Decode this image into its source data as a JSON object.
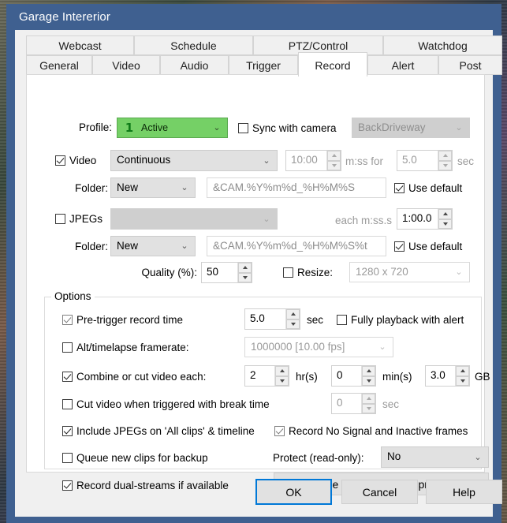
{
  "window": {
    "title": "Garage Intererior"
  },
  "tabs": {
    "top_row": [
      {
        "label": "Webcast",
        "selected": false
      },
      {
        "label": "Schedule",
        "selected": false
      },
      {
        "label": "PTZ/Control",
        "selected": false
      },
      {
        "label": "Watchdog",
        "selected": false
      }
    ],
    "bottom_row": [
      {
        "label": "General",
        "selected": false
      },
      {
        "label": "Video",
        "selected": false
      },
      {
        "label": "Audio",
        "selected": false
      },
      {
        "label": "Trigger",
        "selected": false
      },
      {
        "label": "Record",
        "selected": true
      },
      {
        "label": "Alert",
        "selected": false
      },
      {
        "label": "Post",
        "selected": false
      }
    ]
  },
  "profile_row": {
    "label": "Profile:",
    "profile_number": "1",
    "profile_value": "Active",
    "sync_label": "Sync with camera",
    "sync_checked": false,
    "camera_value": "BackDriveway",
    "camera_disabled": true
  },
  "video_row": {
    "checkbox_label": "Video",
    "checked": true,
    "mode_value": "Continuous",
    "duration_value": "10:00",
    "duration_unit": "m:ss for",
    "post_value": "5.0",
    "post_unit": "sec"
  },
  "video_folder_row": {
    "label": "Folder:",
    "folder_mode": "New",
    "path_value": "&CAM.%Y%m%d_%H%M%S",
    "use_default_label": "Use default",
    "use_default_checked": true
  },
  "jpegs_row": {
    "checkbox_label": "JPEGs",
    "checked": false,
    "mode_value": "",
    "interval_unit": "each m:ss.s",
    "interval_value": "1:00.0"
  },
  "jpegs_folder_row": {
    "label": "Folder:",
    "folder_mode": "New",
    "path_value": "&CAM.%Y%m%d_%H%M%S%t",
    "use_default_label": "Use default",
    "use_default_checked": true
  },
  "quality_row": {
    "label": "Quality (%):",
    "value": "50",
    "resize_label": "Resize:",
    "resize_checked": false,
    "resize_value": "1280 x 720"
  },
  "options": {
    "title": "Options",
    "pre_trigger": {
      "label": "Pre-trigger record time",
      "checked": true,
      "value": "5.0",
      "unit": "sec"
    },
    "fully_playback": {
      "label": "Fully playback with alert",
      "checked": false
    },
    "alt_framerate": {
      "label": "Alt/timelapse framerate:",
      "checked": false,
      "value": "1000000 [10.00 fps]"
    },
    "combine_cut": {
      "label": "Combine or cut video each:",
      "checked": true,
      "hours_value": "2",
      "hours_unit": "hr(s)",
      "minutes_value": "0",
      "minutes_unit": "min(s)",
      "size_value": "3.0",
      "size_unit": "GB"
    },
    "cut_on_trigger": {
      "label": "Cut video when triggered with break time",
      "checked": false,
      "value": "0",
      "unit": "sec"
    },
    "include_jpegs": {
      "label": "Include JPEGs on 'All clips' & timeline",
      "checked": true
    },
    "record_no_signal": {
      "label": "Record No Signal and Inactive frames",
      "checked": true
    },
    "queue_backup": {
      "label": "Queue new clips for backup",
      "checked": false
    },
    "protect": {
      "label": "Protect (read-only):",
      "value": "No"
    },
    "dual_streams": {
      "label": "Record dual-streams if available",
      "checked": true
    },
    "format_button": "Video file format and compression..."
  },
  "buttons": {
    "ok": "OK",
    "cancel": "Cancel",
    "help": "Help"
  },
  "colors": {
    "title_bar": "#3f6090",
    "profile_green": "#75d066",
    "default_button_focus": "#0078d7"
  }
}
